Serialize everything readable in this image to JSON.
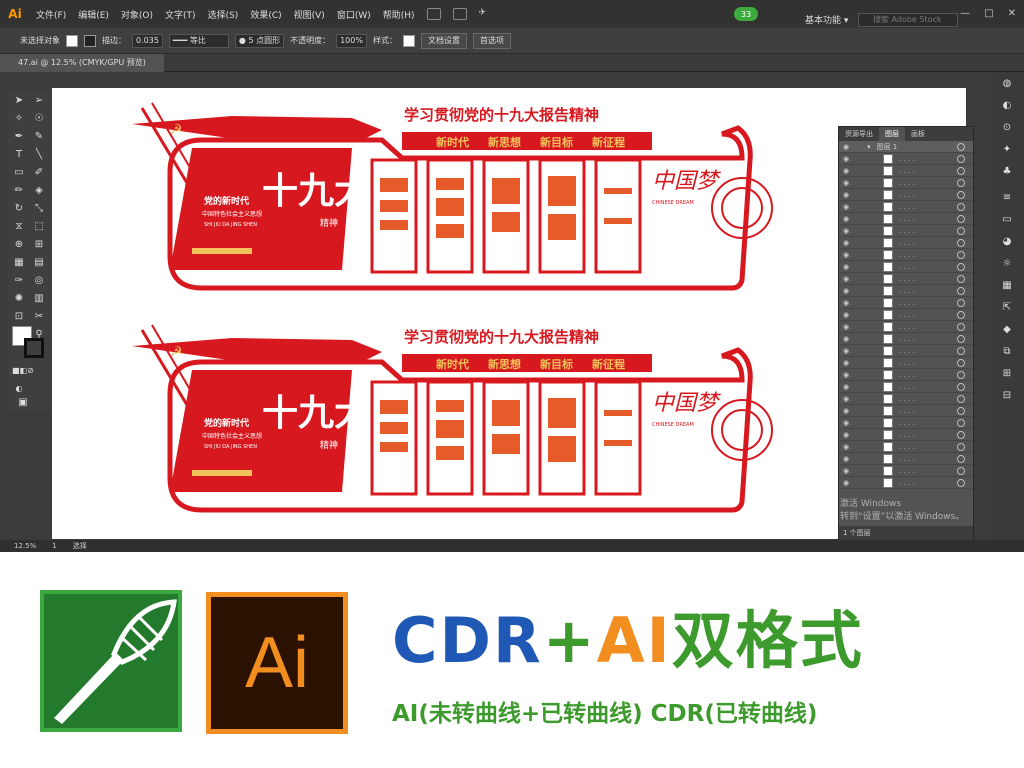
{
  "menubar": {
    "logo": "Ai",
    "items": [
      "文件(F)",
      "编辑(E)",
      "对象(O)",
      "文字(T)",
      "选择(S)",
      "效果(C)",
      "视图(V)",
      "窗口(W)",
      "帮助(H)"
    ],
    "update_badge": "33",
    "workspace": "基本功能",
    "search_placeholder": "搜索 Adobe Stock"
  },
  "controlbar": {
    "selection": "未选择对象",
    "stroke_label": "描边：",
    "stroke_value": "0.035",
    "profile": "等比",
    "brush": "5 点圆形",
    "opacity_label": "不透明度：",
    "opacity_value": "100%",
    "style_label": "样式：",
    "doc_setup": "文档设置",
    "preferences": "首选项"
  },
  "document_tab": "47.ai @ 12.5% (CMYK/GPU 预览)",
  "status": {
    "zoom": "12.5%",
    "artboard": "1",
    "tool": "选择"
  },
  "artwork": {
    "title": "学习贯彻党的十九大报告精神",
    "slogans": [
      "新时代",
      "新思想",
      "新目标",
      "新征程"
    ],
    "big_text": "十九大",
    "side_text": "精神",
    "left_line1": "党的新时代",
    "left_line2": "中国特色社会主义思想",
    "left_pinyin": "SHI JIU DA JING SHEN",
    "right_cn": "中国梦",
    "right_en": "CHINESE DREAM"
  },
  "layers_panel": {
    "tabs": [
      "资源导出",
      "图层",
      "画板"
    ],
    "top_layer": "图层 1",
    "footer": "1 个图层"
  },
  "activate": {
    "line1": "激活 Windows",
    "line2": "转到“设置”以激活 Windows。"
  },
  "promo": {
    "cdr": "CDR",
    "plus": "+",
    "ai": "AI",
    "format": "双格式",
    "subtitle": "AI(未转曲线+已转曲线) CDR(已转曲线)",
    "ai_icon": "Ai"
  },
  "colors": {
    "red": "#d7181f",
    "gold": "#f2c25b",
    "cdr_blue": "#1f59b5",
    "ai_orange": "#f28d1f",
    "green": "#3d9a2c"
  }
}
